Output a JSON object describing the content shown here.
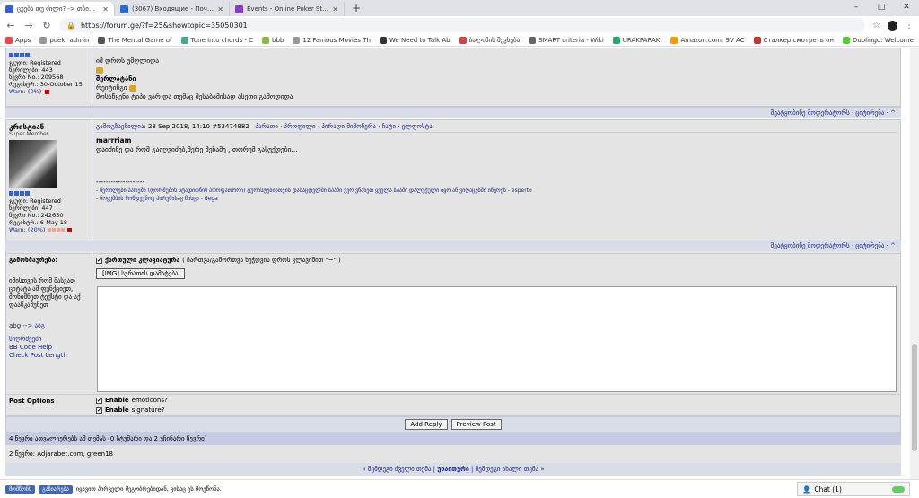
{
  "browser": {
    "tabs": [
      {
        "title": "ცუება თუ ძილი? -> თბილისი",
        "favicon_color": "#3b5fc4",
        "active": true
      },
      {
        "title": "(3067) Входящие - Почта Mail.R",
        "favicon_color": "#2b6cd1",
        "active": false
      },
      {
        "title": "Events - Online Poker Staking",
        "favicon_color": "#8a3bc4",
        "active": false
      }
    ],
    "new_tab": "+",
    "window_controls": [
      "–",
      "□",
      "✕"
    ],
    "url": "https://forum.ge/?f=25&showtopic=35050301",
    "bookmarks": [
      {
        "label": "Apps",
        "color": "#e44"
      },
      {
        "label": "poekr admin",
        "color": "#999"
      },
      {
        "label": "The Mental Game of",
        "color": "#555"
      },
      {
        "label": "Tune into chords - C",
        "color": "#4a8"
      },
      {
        "label": "bbb",
        "color": "#8b4"
      },
      {
        "label": "12 Famous Movies Th",
        "color": "#999"
      },
      {
        "label": "We Need to Talk Ab",
        "color": "#333"
      },
      {
        "label": "ბალიშის შევსება",
        "color": "#c44"
      },
      {
        "label": "SMART criteria - Wiki",
        "color": "#666"
      },
      {
        "label": "URAKPARAKI",
        "color": "#2a6"
      },
      {
        "label": "Amazon.com: 9V AC",
        "color": "#f90"
      },
      {
        "label": "Сталкер смотреть он",
        "color": "#c33"
      },
      {
        "label": "Duolingo: Welcome",
        "color": "#5c3"
      }
    ]
  },
  "post1": {
    "pips": 4,
    "group": "ჯგუფი: Registered",
    "posts": "წერილები: 443",
    "member_no": "წევრი No.: 209568",
    "joined": "რეგისტრ.: 30-October 15",
    "warn": "Warn: (0%)",
    "line1": "იმ დროს უმღლიდა",
    "sig_title": "შერლატანი",
    "sig_line": "რეიტინგი",
    "sig_text": "მოსაწყენი ტიპი ვარ და თემაც შესაბამისად ასეთი გამოდიდა"
  },
  "post1_bar": "შეატყობინე მოდერატორს · ციტირება · ^",
  "post2": {
    "name": "კრისტიან",
    "title": "Super Member",
    "pips": 4,
    "group": "ჯგუფი: Registered",
    "posts": "წერილები: 447",
    "member_no": "წევრი No.: 242630",
    "joined": "რეგისტრ.: 6-May 18",
    "warn": "Warn: (20%)",
    "header_link": "გამოგზავნილია:",
    "header_date": "23 Sep 2018, 14:10",
    "header_id": "#53474882",
    "header_actions": "პარათი · პროფილი · პირადი მიმოწერა · ჩატი · ელფოსტა",
    "body_bold": "marrriam",
    "body_text": "დაიძინე და რომ გაიღვიძებ,მერე მეზამე , თორემ გასუქდები...",
    "sig_sep": "--------------------",
    "sig_line1": "- წერილები პარეში (ფორმუმის სტადიონის პორფათორი) ტურისტებისთვის დასაცდელში სპამი ვერ ვნახეთ ყველა სპამი დალუქული იყო ან ვიღაცებში იწერეს - esperto",
    "sig_line2": "- ნოყემბის მომდევნოე პირებისაც მისცა - dega"
  },
  "post2_bar": "შეატყობინე მოდერატორს · ციტირება · ^",
  "reply": {
    "label": "გამოხმაურება:",
    "side_note": "იმისთვის რომ შასვათ ციტატა ამ ფუნქციეთ, მონიშნეთ ტექსტი და აქ დააწკაპუნეთ",
    "side_link1": "abg --> აბგ",
    "side_link2": "სიღრმეები",
    "side_link3": "BB Code Help",
    "side_link4": "Check Post Length",
    "keyboard_label": "ქართული კლავიატურა",
    "keyboard_hint": "( ჩართვა/გამორთვა ხეჭდვის დროს კლავიშით \"~\" )",
    "img_button": "[IMG] სურათის დამატება"
  },
  "options": {
    "label": "Post Options",
    "opt1_bold": "Enable",
    "opt1_rest": "emoticons?",
    "opt2_bold": "Enable",
    "opt2_rest": "signature?"
  },
  "buttons": {
    "add_reply": "Add Reply",
    "preview": "Preview Post"
  },
  "info": {
    "readers": "4 წევრი ათვალიერებს ამ თემას (0 სტუმარი და 2 უჩინარი წევრი)",
    "members": "2 წევრი: Adjarabet.com, green18"
  },
  "thread_nav": {
    "prev": "« შემდეგი ძველი თემა",
    "current": "უხაითური",
    "next": "შემდეგი ახალი თემა »"
  },
  "footer": {
    "btn1": "მომწონს",
    "btn2": "გაზიარება",
    "text": "იყავით პირველი მეგობრებიდან, ვისაც ეს მოეწონა.",
    "chat": "Chat (1)"
  }
}
